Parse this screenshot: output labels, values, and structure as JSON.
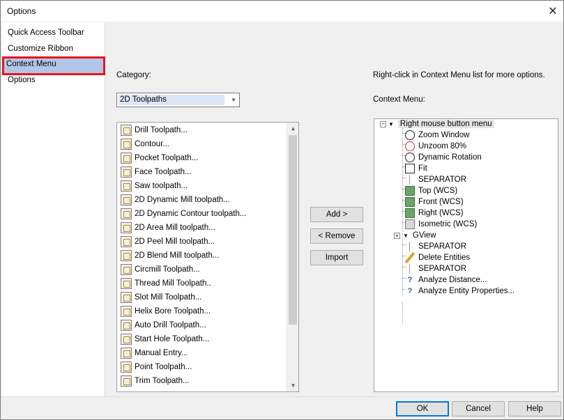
{
  "window": {
    "title": "Options"
  },
  "left_nav": {
    "items": [
      {
        "label": "Quick Access Toolbar",
        "selected": false
      },
      {
        "label": "Customize Ribbon",
        "selected": false
      },
      {
        "label": "Context Menu",
        "selected": true
      },
      {
        "label": "Options",
        "selected": false
      }
    ]
  },
  "main": {
    "category_label": "Category:",
    "category_value": "2D Toolpaths",
    "hint": "Right-click in Context Menu list for more options.",
    "context_menu_label": "Context Menu:",
    "buttons": {
      "add": "Add >",
      "remove": "< Remove",
      "import": "Import"
    },
    "commands": [
      "Drill Toolpath...",
      "Contour...",
      "Pocket Toolpath...",
      "Face Toolpath...",
      "Saw toolpath...",
      "2D Dynamic Mill toolpath...",
      "2D Dynamic Contour toolpath...",
      "2D Area Mill toolpath...",
      "2D Peel Mill toolpath...",
      "2D Blend Mill toolpath...",
      "Circmill Toolpath...",
      "Thread Mill Toolpath..",
      "Slot Mill Toolpath...",
      "Helix Bore Toolpath...",
      "Auto Drill Toolpath...",
      "Start Hole Toolpath...",
      "Manual Entry...",
      "Point Toolpath...",
      "Trim Toolpath..."
    ],
    "context_tree": {
      "root": "Right mouse button menu",
      "items": [
        {
          "label": "Zoom Window",
          "icon": "zoom-window-icon"
        },
        {
          "label": "Unzoom 80%",
          "icon": "unzoom-icon"
        },
        {
          "label": "Dynamic Rotation",
          "icon": "dynamic-rotation-icon"
        },
        {
          "label": "Fit",
          "icon": "fit-icon"
        },
        {
          "label": "SEPARATOR",
          "icon": "separator-icon"
        },
        {
          "label": "Top (WCS)",
          "icon": "view-cube-icon"
        },
        {
          "label": "Front (WCS)",
          "icon": "view-cube-icon"
        },
        {
          "label": "Right (WCS)",
          "icon": "view-cube-icon"
        },
        {
          "label": "Isometric (WCS)",
          "icon": "view-cube-icon"
        },
        {
          "label": "GView",
          "icon": "submenu-arrow-icon"
        },
        {
          "label": "SEPARATOR",
          "icon": "separator-icon"
        },
        {
          "label": "Delete Entities",
          "icon": "delete-entities-icon"
        },
        {
          "label": "SEPARATOR",
          "icon": "separator-icon"
        },
        {
          "label": "Analyze Distance...",
          "icon": "analyze-distance-icon"
        },
        {
          "label": "Analyze Entity Properties...",
          "icon": "analyze-entity-icon"
        }
      ]
    }
  },
  "footer": {
    "ok": "OK",
    "cancel": "Cancel",
    "help": "Help"
  }
}
